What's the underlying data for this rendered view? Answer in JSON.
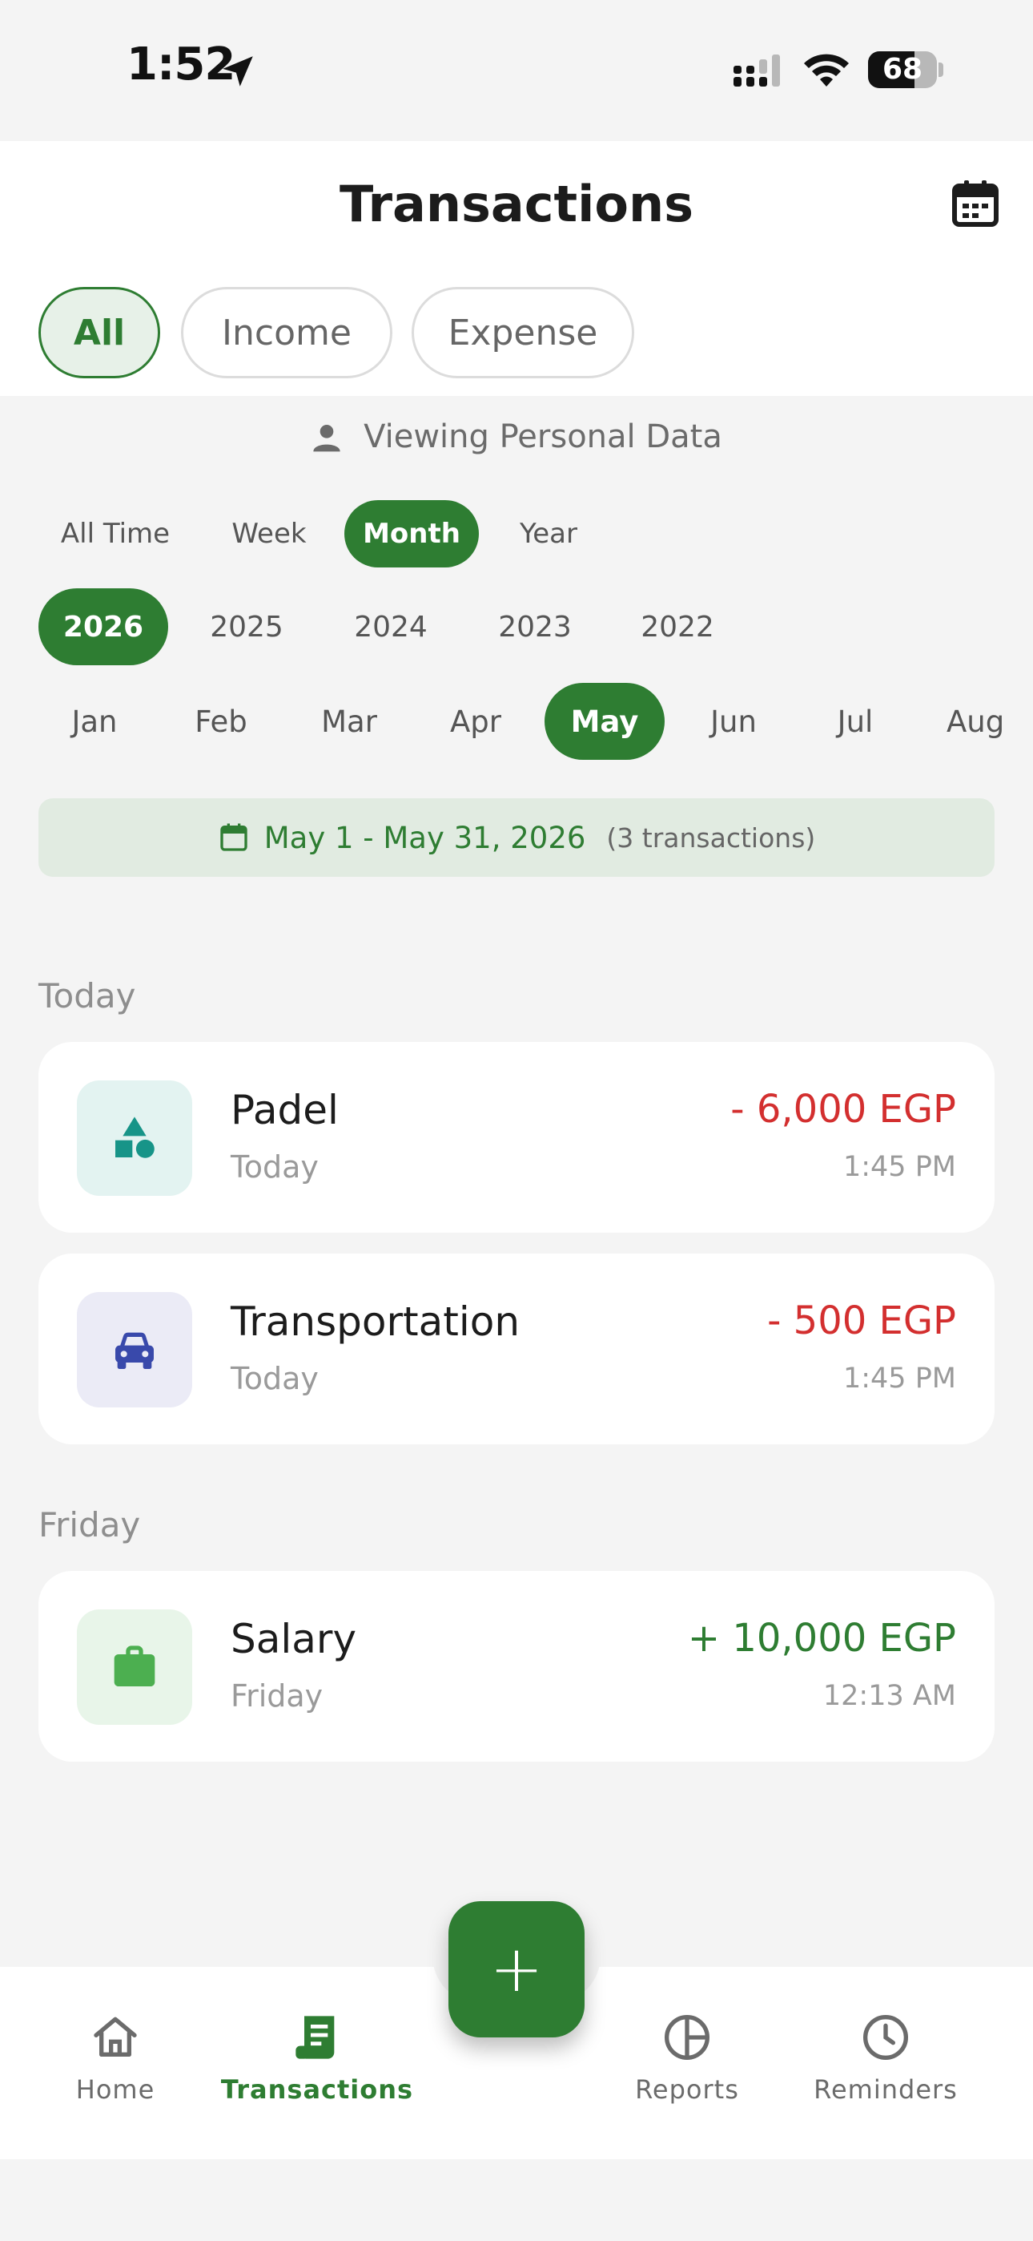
{
  "status_bar": {
    "time": "1:52",
    "battery": "68",
    "battery_level": 0.68
  },
  "header": {
    "title": "Transactions"
  },
  "type_filters": [
    {
      "label": "All",
      "active": true
    },
    {
      "label": "Income",
      "active": false
    },
    {
      "label": "Expense",
      "active": false
    }
  ],
  "viewing": {
    "text": "Viewing Personal Data"
  },
  "period_filters": [
    {
      "label": "All Time",
      "active": false
    },
    {
      "label": "Week",
      "active": false
    },
    {
      "label": "Month",
      "active": true
    },
    {
      "label": "Year",
      "active": false
    }
  ],
  "years": [
    {
      "label": "2026",
      "active": true
    },
    {
      "label": "2025",
      "active": false
    },
    {
      "label": "2024",
      "active": false
    },
    {
      "label": "2023",
      "active": false
    },
    {
      "label": "2022",
      "active": false
    }
  ],
  "months": [
    {
      "label": "Jan",
      "active": false
    },
    {
      "label": "Feb",
      "active": false
    },
    {
      "label": "Mar",
      "active": false
    },
    {
      "label": "Apr",
      "active": false
    },
    {
      "label": "May",
      "active": true
    },
    {
      "label": "Jun",
      "active": false
    },
    {
      "label": "Jul",
      "active": false
    },
    {
      "label": "Aug",
      "active": false
    }
  ],
  "range": {
    "text": "May 1 - May 31, 2026",
    "count": "(3 transactions)"
  },
  "sections": [
    {
      "label": "Today",
      "transactions": [
        {
          "title": "Padel",
          "subtitle": "Today",
          "amount": "- 6,000 EGP",
          "time": "1:45 PM",
          "type": "expense",
          "icon": "shapes-icon"
        },
        {
          "title": "Transportation",
          "subtitle": "Today",
          "amount": "- 500 EGP",
          "time": "1:45 PM",
          "type": "expense",
          "icon": "car-icon"
        }
      ]
    },
    {
      "label": "Friday",
      "transactions": [
        {
          "title": "Salary",
          "subtitle": "Friday",
          "amount": "+ 10,000 EGP",
          "time": "12:13 AM",
          "type": "income",
          "icon": "briefcase-icon"
        }
      ]
    }
  ],
  "fab": {
    "label": "+"
  },
  "bottom_nav": [
    {
      "label": "Home",
      "icon": "home-icon",
      "active": false
    },
    {
      "label": "Transactions",
      "icon": "receipt-icon",
      "active": true
    },
    {
      "label": "Reports",
      "icon": "pie-chart-icon",
      "active": false
    },
    {
      "label": "Reminders",
      "icon": "clock-icon",
      "active": false
    }
  ],
  "colors": {
    "primary": "#2e7d32",
    "expense": "#d32f2f",
    "income": "#2e7d32",
    "padel_icon": "#179488",
    "transport_icon": "#3949ab",
    "salary_icon": "#4caf50"
  }
}
